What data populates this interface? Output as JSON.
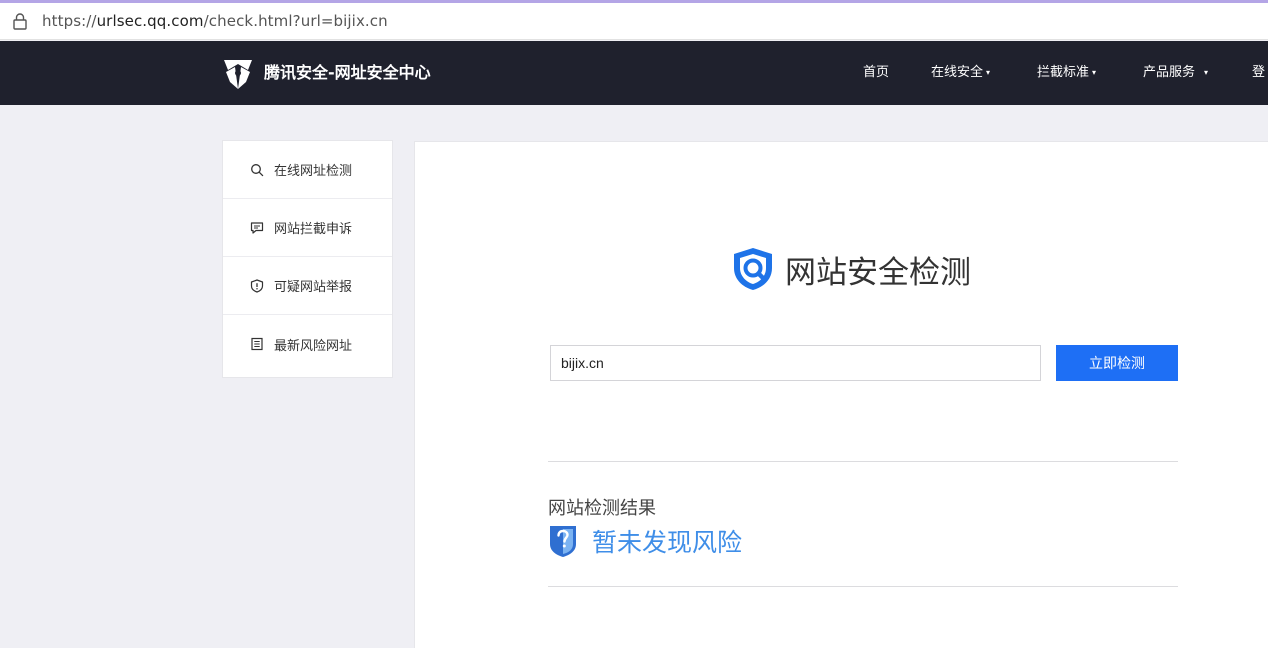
{
  "browser": {
    "url_prefix": "https://",
    "url_host": "urlsec.qq.com",
    "url_path": "/check.html?url=bijix.cn"
  },
  "header": {
    "brand": "腾讯安全-网址安全中心",
    "nav": [
      {
        "label": "首页",
        "has_dropdown": false
      },
      {
        "label": "在线安全",
        "has_dropdown": true
      },
      {
        "label": "拦截标准",
        "has_dropdown": true
      },
      {
        "label": "产品服务",
        "has_dropdown": true
      },
      {
        "label": "登",
        "has_dropdown": false
      }
    ],
    "dropdown_glyph": "▾"
  },
  "sidebar": {
    "items": [
      {
        "label": "在线网址检测",
        "icon": "search-icon"
      },
      {
        "label": "网站拦截申诉",
        "icon": "chat-icon"
      },
      {
        "label": "可疑网站举报",
        "icon": "shield-alert-icon"
      },
      {
        "label": "最新风险网址",
        "icon": "list-icon"
      }
    ]
  },
  "main": {
    "title": "网站安全检测",
    "search": {
      "value": "bijix.cn",
      "button_label": "立即检测"
    },
    "result": {
      "label": "网站检测结果",
      "status": "暂未发现风险"
    }
  },
  "colors": {
    "header_bg": "#1f212d",
    "accent_blue": "#1e6ff5",
    "result_blue": "#3f8ee8",
    "page_bg": "#efeff4"
  }
}
